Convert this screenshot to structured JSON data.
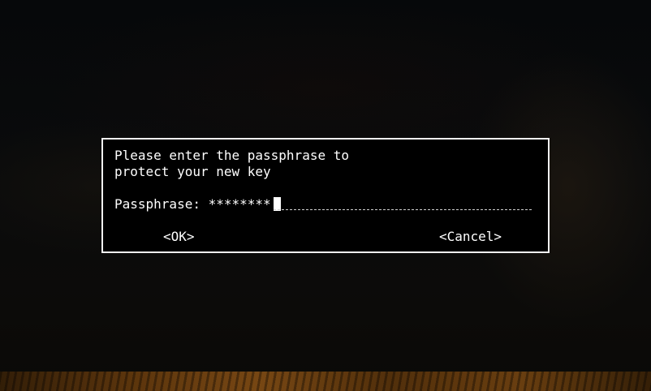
{
  "dialog": {
    "prompt_line_1": "Please enter the passphrase to",
    "prompt_line_2": "protect your new key",
    "passphrase_label": "Passphrase: ",
    "passphrase_value": "********",
    "ok_label": "<OK>",
    "cancel_label": "<Cancel>"
  },
  "colors": {
    "dialog_background": "#000000",
    "dialog_border": "#f2f2f2",
    "text": "#ffffff"
  }
}
